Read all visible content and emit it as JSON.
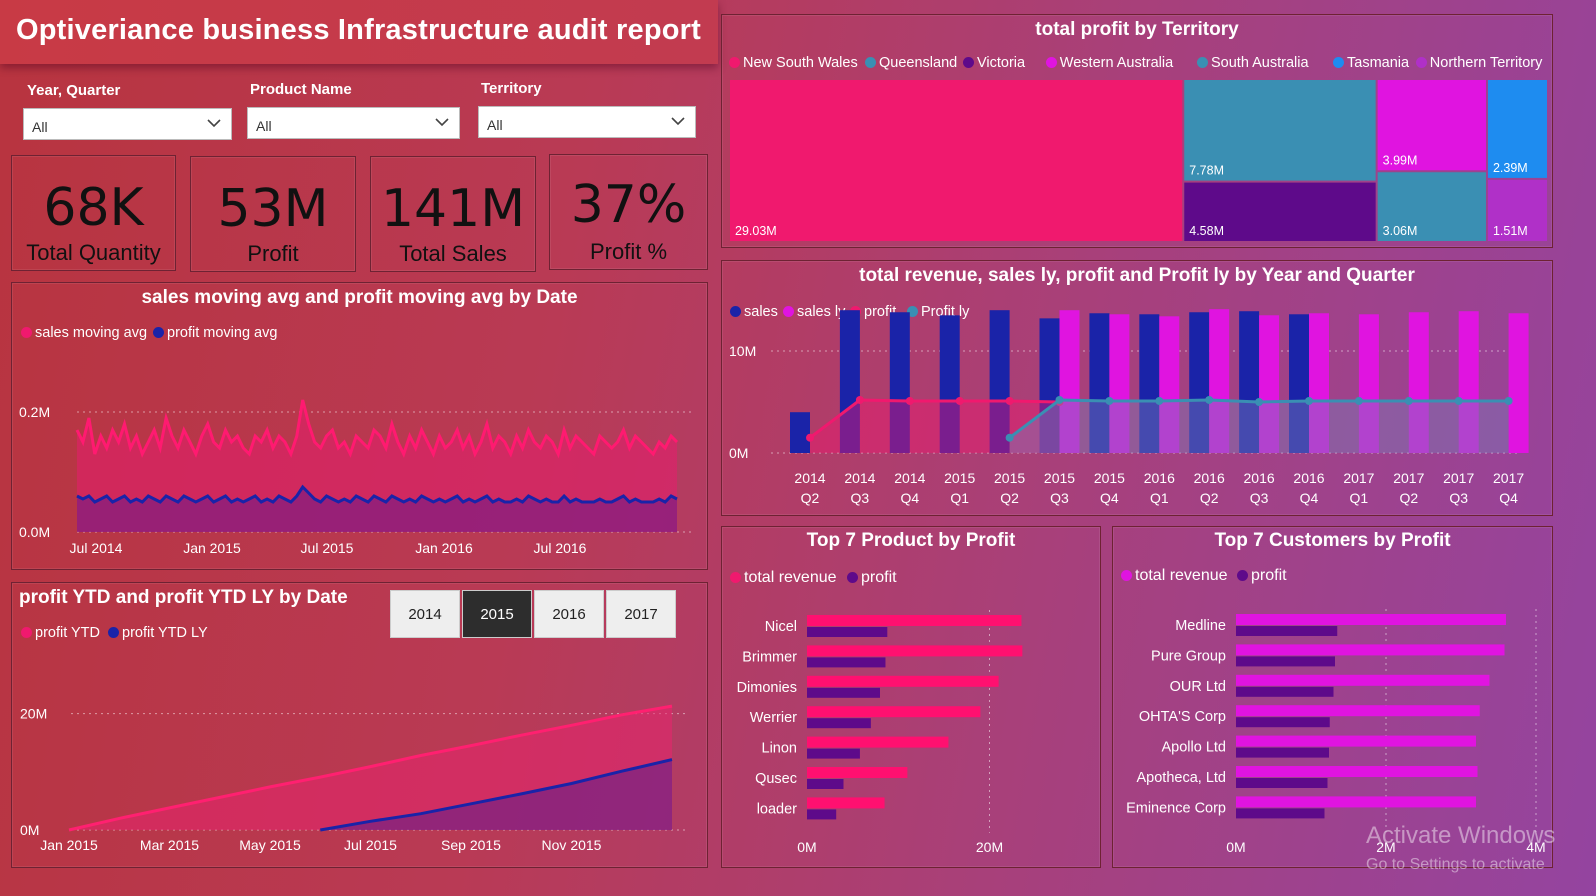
{
  "header": {
    "title": "Optiveriance business Infrastructure audit report"
  },
  "slicers": [
    {
      "label": "Year, Quarter",
      "value": "All"
    },
    {
      "label": "Product Name",
      "value": "All"
    },
    {
      "label": "Territory",
      "value": "All"
    }
  ],
  "kpis": [
    {
      "value": "68K",
      "label": "Total Quantity"
    },
    {
      "value": "53M",
      "label": "Profit"
    },
    {
      "value": "141M",
      "label": "Total Sales"
    },
    {
      "value": "37%",
      "label": "Profit %"
    }
  ],
  "year_buttons": [
    "2014",
    "2015",
    "2016",
    "2017"
  ],
  "selected_year": "2015",
  "watermark": {
    "line1": "Activate Windows",
    "line2": "Go to Settings to activate"
  },
  "colors": {
    "pink": "#f0196e",
    "navy": "#1a23a8",
    "magenta": "#e014e0",
    "teal": "#3a8fb3",
    "purple": "#5e0a8a",
    "blue": "#1e8cf0",
    "violet": "#b030c8"
  },
  "chart_data": [
    {
      "id": "treemap",
      "type": "treemap",
      "title": "total profit by Territory",
      "legend": [
        "New South Wales",
        "Queensland",
        "Victoria",
        "Western Australia",
        "South Australia",
        "Tasmania",
        "Northern Territory"
      ],
      "legend_colors": [
        "#f0196e",
        "#3a8fb3",
        "#5e0a8a",
        "#e014e0",
        "#3a8fb3",
        "#1e8cf0",
        "#b030c8"
      ],
      "items": [
        {
          "name": "New South Wales",
          "label": "29.03M",
          "value": 29.03
        },
        {
          "name": "Queensland",
          "label": "7.78M",
          "value": 7.78
        },
        {
          "name": "Victoria",
          "label": "4.58M",
          "value": 4.58
        },
        {
          "name": "Western Australia",
          "label": "3.99M",
          "value": 3.99
        },
        {
          "name": "South Australia",
          "label": "3.06M",
          "value": 3.06
        },
        {
          "name": "Tasmania",
          "label": "2.39M",
          "value": 2.39
        },
        {
          "name": "Northern Territory",
          "label": "1.51M",
          "value": 1.51
        }
      ]
    },
    {
      "id": "moving_avg",
      "type": "area",
      "title": "sales moving avg and profit moving avg by Date",
      "legend": [
        "sales moving avg",
        "profit moving avg"
      ],
      "x_ticks": [
        "Jul 2014",
        "Jan 2015",
        "Jul 2015",
        "Jan 2016",
        "Jul 2016"
      ],
      "y_ticks": [
        "0.0M",
        "0.2M"
      ],
      "ylim": [
        0,
        0.25
      ],
      "series": [
        {
          "name": "sales moving avg",
          "values": [
            0.17,
            0.15,
            0.19,
            0.13,
            0.16,
            0.14,
            0.17,
            0.15,
            0.18,
            0.14,
            0.16,
            0.13,
            0.15,
            0.17,
            0.14,
            0.19,
            0.16,
            0.14,
            0.17,
            0.15,
            0.13,
            0.16,
            0.18,
            0.15,
            0.14,
            0.17,
            0.15,
            0.16,
            0.14,
            0.13,
            0.16,
            0.15,
            0.17,
            0.14,
            0.16,
            0.15,
            0.13,
            0.16,
            0.22,
            0.18,
            0.15,
            0.14,
            0.16,
            0.17,
            0.14,
            0.15,
            0.13,
            0.16,
            0.15,
            0.14,
            0.17,
            0.16,
            0.14,
            0.18,
            0.15,
            0.13,
            0.16,
            0.14,
            0.17,
            0.15,
            0.13,
            0.16,
            0.14,
            0.15,
            0.17,
            0.14,
            0.16,
            0.13,
            0.15,
            0.18,
            0.14,
            0.16,
            0.15,
            0.13,
            0.16,
            0.14,
            0.17,
            0.15,
            0.14,
            0.16,
            0.15,
            0.13,
            0.17,
            0.14,
            0.16,
            0.15,
            0.14,
            0.13,
            0.16,
            0.15,
            0.14,
            0.15,
            0.17,
            0.14,
            0.16,
            0.15,
            0.14,
            0.13,
            0.15,
            0.14,
            0.16,
            0.15
          ]
        },
        {
          "name": "profit moving avg",
          "values": [
            0.06,
            0.055,
            0.06,
            0.05,
            0.055,
            0.06,
            0.05,
            0.055,
            0.06,
            0.05,
            0.055,
            0.05,
            0.06,
            0.055,
            0.05,
            0.06,
            0.055,
            0.05,
            0.06,
            0.055,
            0.05,
            0.055,
            0.06,
            0.05,
            0.055,
            0.06,
            0.05,
            0.055,
            0.05,
            0.055,
            0.06,
            0.05,
            0.055,
            0.05,
            0.06,
            0.055,
            0.05,
            0.06,
            0.075,
            0.065,
            0.055,
            0.05,
            0.06,
            0.055,
            0.05,
            0.055,
            0.05,
            0.06,
            0.055,
            0.05,
            0.06,
            0.055,
            0.05,
            0.06,
            0.055,
            0.05,
            0.055,
            0.05,
            0.06,
            0.055,
            0.05,
            0.055,
            0.05,
            0.055,
            0.06,
            0.05,
            0.055,
            0.05,
            0.055,
            0.06,
            0.05,
            0.055,
            0.05,
            0.05,
            0.055,
            0.05,
            0.06,
            0.055,
            0.05,
            0.055,
            0.05,
            0.05,
            0.06,
            0.05,
            0.055,
            0.05,
            0.05,
            0.05,
            0.055,
            0.05,
            0.05,
            0.055,
            0.06,
            0.05,
            0.055,
            0.05,
            0.05,
            0.05,
            0.055,
            0.05,
            0.06,
            0.055
          ]
        }
      ]
    },
    {
      "id": "ytd",
      "type": "area",
      "title": "profit YTD and profit YTD LY by Date",
      "legend": [
        "profit YTD",
        "profit YTD LY"
      ],
      "x_ticks": [
        "Jan 2015",
        "Mar 2015",
        "May 2015",
        "Jul 2015",
        "Sep 2015",
        "Nov 2015"
      ],
      "y_ticks": [
        "0M",
        "20M"
      ],
      "ylim": [
        0,
        22
      ],
      "series": [
        {
          "name": "profit YTD",
          "start": 0,
          "end": 12,
          "values": [
            0,
            2.0,
            3.8,
            5.6,
            7.4,
            9.1,
            10.9,
            12.8,
            14.5,
            16.3,
            18.0,
            19.8,
            21.3
          ]
        },
        {
          "name": "profit YTD LY",
          "start": 5,
          "end": 12,
          "values": [
            0,
            1.5,
            2.8,
            4.5,
            6.2,
            8.0,
            10.1,
            12.1
          ]
        }
      ]
    },
    {
      "id": "combo",
      "type": "bar",
      "title": "total revenue, sales ly, profit and Profit ly by Year and Quarter",
      "legend": [
        "sales",
        "sales ly",
        "profit",
        "Profit ly"
      ],
      "categories": [
        "2014 Q2",
        "2014 Q3",
        "2014 Q4",
        "2015 Q1",
        "2015 Q2",
        "2015 Q3",
        "2015 Q4",
        "2016 Q1",
        "2016 Q2",
        "2016 Q3",
        "2016 Q4",
        "2017 Q1",
        "2017 Q2",
        "2017 Q3",
        "2017 Q4"
      ],
      "y_ticks": [
        "0M",
        "10M"
      ],
      "ylim": [
        0,
        15
      ],
      "series": [
        {
          "name": "sales",
          "values": [
            4.0,
            14.0,
            13.8,
            13.5,
            14.0,
            13.2,
            13.7,
            13.6,
            13.8,
            13.9,
            13.6,
            null,
            null,
            null,
            null
          ]
        },
        {
          "name": "sales ly",
          "values": [
            null,
            null,
            null,
            null,
            null,
            14.0,
            13.6,
            13.4,
            14.1,
            13.5,
            13.7,
            13.6,
            13.8,
            13.9,
            13.7
          ]
        },
        {
          "name": "profit",
          "values": [
            1.5,
            5.2,
            5.1,
            5.1,
            5.1,
            5.0,
            null,
            null,
            null,
            null,
            null,
            null,
            null,
            null,
            null
          ]
        },
        {
          "name": "Profit ly",
          "values": [
            null,
            null,
            null,
            null,
            1.5,
            5.2,
            5.1,
            5.1,
            5.2,
            5.0,
            5.1,
            5.1,
            5.1,
            5.1,
            5.1
          ]
        }
      ]
    },
    {
      "id": "top_products",
      "type": "bar",
      "title": "Top 7 Product by Profit",
      "legend": [
        "total revenue",
        "profit"
      ],
      "categories": [
        "Nicel",
        "Brimmer",
        "Dimonies",
        "Werrier",
        "Linon",
        "Qusec",
        "loader"
      ],
      "x_ticks": [
        "0M",
        "20M"
      ],
      "xlim": [
        0,
        40
      ],
      "series": [
        {
          "name": "total revenue",
          "values": [
            23.5,
            23.6,
            21.0,
            19.0,
            15.5,
            11.0,
            8.5
          ]
        },
        {
          "name": "profit",
          "values": [
            8.8,
            8.6,
            8.0,
            7.0,
            5.8,
            4.0,
            3.2
          ]
        }
      ]
    },
    {
      "id": "top_customers",
      "type": "bar",
      "title": "Top 7 Customers by Profit",
      "legend": [
        "total revenue",
        "profit"
      ],
      "categories": [
        "Medline",
        "Pure Group",
        "OUR Ltd",
        "OHTA'S Corp",
        "Apollo Ltd",
        "Apotheca, Ltd",
        "Eminence Corp"
      ],
      "x_ticks": [
        "0M",
        "2M",
        "4M"
      ],
      "xlim": [
        0,
        4
      ],
      "series": [
        {
          "name": "total revenue",
          "values": [
            3.6,
            3.58,
            3.38,
            3.25,
            3.2,
            3.22,
            3.2
          ]
        },
        {
          "name": "profit",
          "values": [
            1.35,
            1.32,
            1.3,
            1.25,
            1.24,
            1.22,
            1.18
          ]
        }
      ]
    }
  ]
}
